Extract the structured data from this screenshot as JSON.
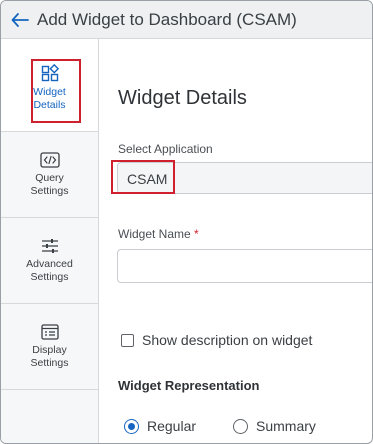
{
  "header": {
    "title": "Add Widget to Dashboard (CSAM)"
  },
  "sidebar": {
    "items": [
      {
        "label_line1": "Widget",
        "label_line2": "Details",
        "icon": "widgets-icon"
      },
      {
        "label_line1": "Query",
        "label_line2": "Settings",
        "icon": "code-icon"
      },
      {
        "label_line1": "Advanced",
        "label_line2": "Settings",
        "icon": "sliders-icon"
      },
      {
        "label_line1": "Display",
        "label_line2": "Settings",
        "icon": "display-settings-icon"
      }
    ]
  },
  "main": {
    "title": "Widget Details",
    "select_application": {
      "label": "Select Application",
      "value": "CSAM"
    },
    "widget_name": {
      "label": "Widget Name",
      "required_marker": "*",
      "value": ""
    },
    "show_description": {
      "label": "Show description on widget",
      "checked": false
    },
    "representation": {
      "title": "Widget Representation",
      "options": [
        {
          "label": "Regular",
          "selected": true
        },
        {
          "label": "Summary",
          "selected": false
        }
      ]
    }
  },
  "colors": {
    "accent": "#1565c0",
    "highlight": "#d0202e"
  }
}
